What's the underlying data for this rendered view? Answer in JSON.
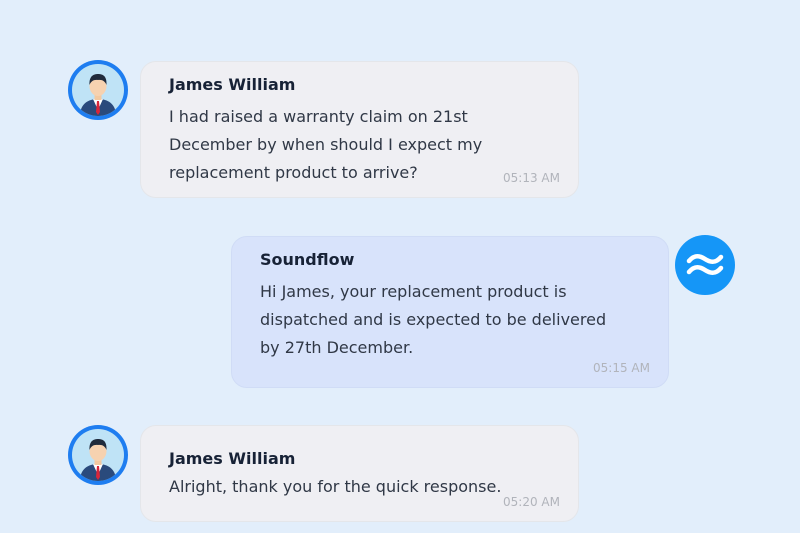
{
  "messages": [
    {
      "sender": "James William",
      "text": "I had raised a warranty claim on 21st\nDecember by when should I expect my\nreplacement product to arrive?",
      "time": "05:13 AM",
      "role": "user",
      "avatar_icon": "user-avatar-icon"
    },
    {
      "sender": "Soundflow",
      "text": "Hi James, your replacement product is\ndispatched and is expected to be delivered\nby 27th December.",
      "time": "05:15 AM",
      "role": "agent",
      "avatar_icon": "soundflow-logo-icon"
    },
    {
      "sender": "James William",
      "text": "Alright, thank you for the quick response.",
      "time": "05:20 AM",
      "role": "user",
      "avatar_icon": "user-avatar-icon"
    }
  ],
  "colors": {
    "background": "#e2eefb",
    "user_bubble": "#efeff3",
    "agent_bubble": "#d8e3fb",
    "brand_blue": "#1596f7",
    "avatar_ring": "#1e7df0"
  }
}
